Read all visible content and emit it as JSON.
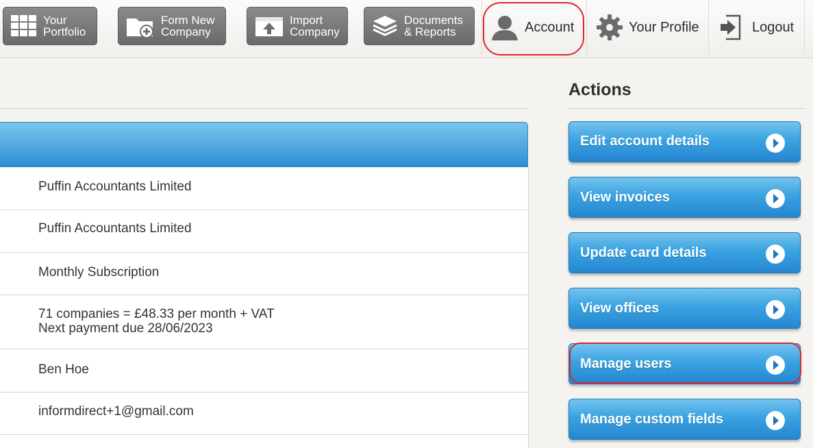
{
  "nav": {
    "portfolio": [
      "Your",
      "Portfolio"
    ],
    "form_new": [
      "Form New",
      "Company"
    ],
    "import": [
      "Import",
      "Company"
    ],
    "documents": [
      "Documents",
      "& Reports"
    ],
    "account": "Account",
    "profile": "Your Profile",
    "logout": "Logout"
  },
  "account_info": {
    "rows": [
      "Puffin Accountants Limited",
      "Puffin Accountants Limited",
      "Monthly Subscription",
      "71 companies = £48.33 per month + VAT",
      "Next payment due 28/06/2023",
      "Ben Hoe",
      "informdirect+1@gmail.com"
    ]
  },
  "actions": {
    "title": "Actions",
    "buttons": [
      "Edit account details",
      "View invoices",
      "Update card details",
      "View offices",
      "Manage users",
      "Manage custom fields"
    ]
  },
  "colors": {
    "nav_button": "#707070",
    "action_blue": "#3aa3e2",
    "highlight_red": "#d9262c"
  }
}
